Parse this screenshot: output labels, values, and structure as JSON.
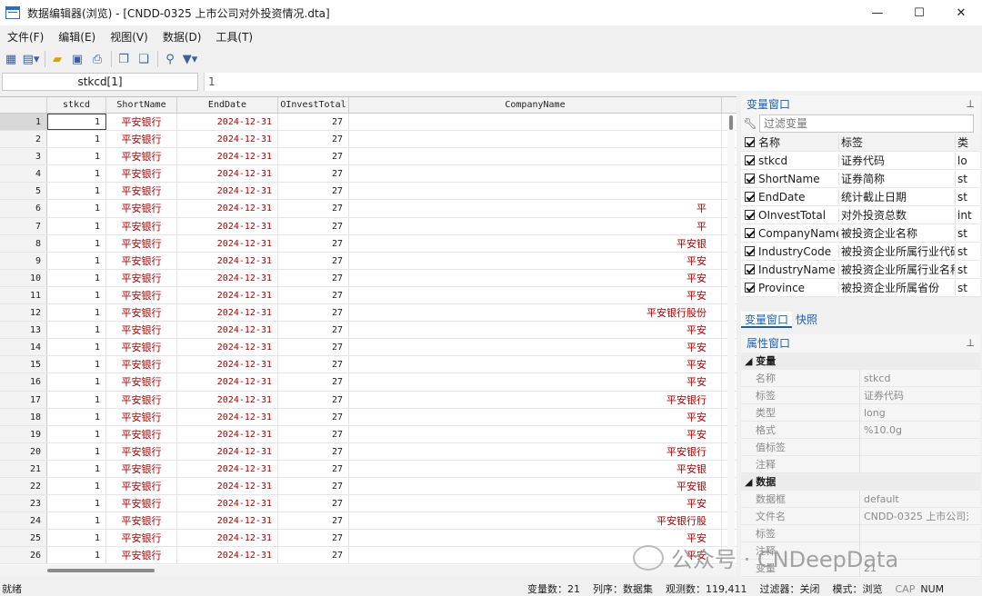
{
  "window": {
    "title": "数据编辑器(浏览) - [CNDD-0325 上市公司对外投资情况.dta]",
    "controls": {
      "minimize": "—",
      "maximize": "☐",
      "close": "✕"
    }
  },
  "menu": [
    "文件(F)",
    "编辑(E)",
    "视图(V)",
    "数据(D)",
    "工具(T)"
  ],
  "editbar": {
    "cell_ref": "stkcd[1]",
    "value": "1"
  },
  "grid": {
    "columns": [
      "stkcd",
      "ShortName",
      "EndDate",
      "OInvestTotal",
      "CompanyName"
    ],
    "rows": [
      [
        "1",
        "1",
        "平安银行",
        "2024-12-31",
        "27",
        ""
      ],
      [
        "2",
        "1",
        "平安银行",
        "2024-12-31",
        "27",
        ""
      ],
      [
        "3",
        "1",
        "平安银行",
        "2024-12-31",
        "27",
        ""
      ],
      [
        "4",
        "1",
        "平安银行",
        "2024-12-31",
        "27",
        ""
      ],
      [
        "5",
        "1",
        "平安银行",
        "2024-12-31",
        "27",
        ""
      ],
      [
        "6",
        "1",
        "平安银行",
        "2024-12-31",
        "27",
        "平"
      ],
      [
        "7",
        "1",
        "平安银行",
        "2024-12-31",
        "27",
        "平"
      ],
      [
        "8",
        "1",
        "平安银行",
        "2024-12-31",
        "27",
        "平安银"
      ],
      [
        "9",
        "1",
        "平安银行",
        "2024-12-31",
        "27",
        "平安"
      ],
      [
        "10",
        "1",
        "平安银行",
        "2024-12-31",
        "27",
        "平安"
      ],
      [
        "11",
        "1",
        "平安银行",
        "2024-12-31",
        "27",
        "平安"
      ],
      [
        "12",
        "1",
        "平安银行",
        "2024-12-31",
        "27",
        "平安银行股份"
      ],
      [
        "13",
        "1",
        "平安银行",
        "2024-12-31",
        "27",
        "平安"
      ],
      [
        "14",
        "1",
        "平安银行",
        "2024-12-31",
        "27",
        "平安"
      ],
      [
        "15",
        "1",
        "平安银行",
        "2024-12-31",
        "27",
        "平安"
      ],
      [
        "16",
        "1",
        "平安银行",
        "2024-12-31",
        "27",
        "平安"
      ],
      [
        "17",
        "1",
        "平安银行",
        "2024-12-31",
        "27",
        "平安银行"
      ],
      [
        "18",
        "1",
        "平安银行",
        "2024-12-31",
        "27",
        "平安"
      ],
      [
        "19",
        "1",
        "平安银行",
        "2024-12-31",
        "27",
        "平安"
      ],
      [
        "20",
        "1",
        "平安银行",
        "2024-12-31",
        "27",
        "平安银行"
      ],
      [
        "21",
        "1",
        "平安银行",
        "2024-12-31",
        "27",
        "平安银"
      ],
      [
        "22",
        "1",
        "平安银行",
        "2024-12-31",
        "27",
        "平安银"
      ],
      [
        "23",
        "1",
        "平安银行",
        "2024-12-31",
        "27",
        "平安"
      ],
      [
        "24",
        "1",
        "平安银行",
        "2024-12-31",
        "27",
        "平安银行股"
      ],
      [
        "25",
        "1",
        "平安银行",
        "2024-12-31",
        "27",
        "平安"
      ],
      [
        "26",
        "1",
        "平安银行",
        "2024-12-31",
        "27",
        "平安"
      ]
    ]
  },
  "variables_panel": {
    "title": "变量窗口",
    "filter_placeholder": "过滤变量",
    "header": {
      "name": "名称",
      "label": "标签",
      "type": "类"
    },
    "rows": [
      {
        "name": "stkcd",
        "label": "证券代码",
        "type": "lo"
      },
      {
        "name": "ShortName",
        "label": "证券简称",
        "type": "st"
      },
      {
        "name": "EndDate",
        "label": "统计截止日期",
        "type": "st"
      },
      {
        "name": "OInvestTotal",
        "label": "对外投资总数",
        "type": "int"
      },
      {
        "name": "CompanyName",
        "label": "被投资企业名称",
        "type": "st"
      },
      {
        "name": "IndustryCode",
        "label": "被投资企业所属行业代码",
        "type": "st"
      },
      {
        "name": "IndustryName",
        "label": "被投资企业所属行业名称",
        "type": "st"
      },
      {
        "name": "Province",
        "label": "被投资企业所属省份",
        "type": "st"
      }
    ],
    "tabs": [
      "变量窗口",
      "快照"
    ]
  },
  "properties_panel": {
    "title": "属性窗口",
    "sections": [
      {
        "title": "变量",
        "items": [
          {
            "key": "名称",
            "value": "stkcd"
          },
          {
            "key": "标签",
            "value": "证券代码"
          },
          {
            "key": "类型",
            "value": "long"
          },
          {
            "key": "格式",
            "value": "%10.0g"
          },
          {
            "key": "值标签",
            "value": ""
          },
          {
            "key": "注释",
            "value": ""
          }
        ]
      },
      {
        "title": "数据",
        "items": [
          {
            "key": "数据框",
            "value": "default"
          },
          {
            "key": "文件名",
            "value": "CNDD-0325 上市公司对"
          },
          {
            "key": "标签",
            "value": ""
          },
          {
            "key": "注释",
            "value": ""
          },
          {
            "key": "变量",
            "value": "21"
          }
        ]
      }
    ]
  },
  "statusbar": {
    "ready": "就绪",
    "var_count": "变量数：21",
    "order": "列序：数据集",
    "obs_count": "观测数：119,411",
    "filter": "过滤器：关闭",
    "mode": "模式：浏览",
    "cap": "CAP",
    "num": "NUM"
  },
  "watermark": "公众号 · CNDeepData",
  "colors": {
    "accent": "#1a5fb4",
    "string_value": "#b00000"
  }
}
